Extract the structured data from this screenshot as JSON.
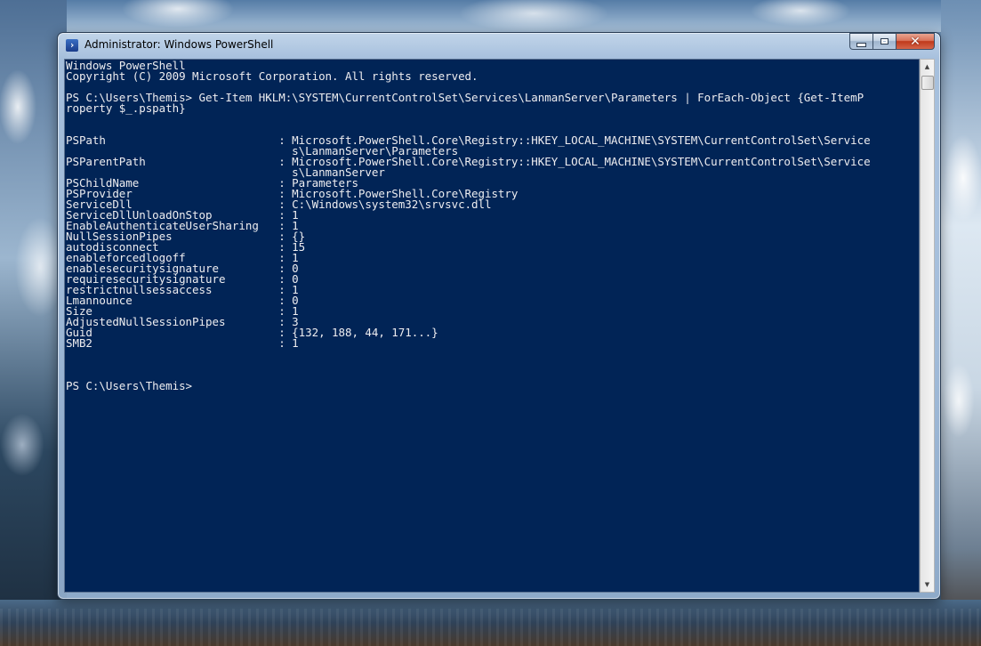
{
  "window": {
    "title": "Administrator: Windows PowerShell",
    "icon": "powershell-icon",
    "icon_glyph": "›",
    "close_glyph": "✕",
    "console_background": "#012456",
    "console_text_color": "#eeedf0"
  },
  "console": {
    "lines": [
      "Windows PowerShell",
      "Copyright (C) 2009 Microsoft Corporation. All rights reserved.",
      "",
      "PS C:\\Users\\Themis> Get-Item HKLM:\\SYSTEM\\CurrentControlSet\\Services\\LanmanServer\\Parameters | ForEach-Object {Get-ItemP",
      "roperty $_.pspath}",
      "",
      "",
      "PSPath                          : Microsoft.PowerShell.Core\\Registry::HKEY_LOCAL_MACHINE\\SYSTEM\\CurrentControlSet\\Service",
      "                                  s\\LanmanServer\\Parameters",
      "PSParentPath                    : Microsoft.PowerShell.Core\\Registry::HKEY_LOCAL_MACHINE\\SYSTEM\\CurrentControlSet\\Service",
      "                                  s\\LanmanServer",
      "PSChildName                     : Parameters",
      "PSProvider                      : Microsoft.PowerShell.Core\\Registry",
      "ServiceDll                      : C:\\Windows\\system32\\srvsvc.dll",
      "ServiceDllUnloadOnStop          : 1",
      "EnableAuthenticateUserSharing   : 1",
      "NullSessionPipes                : {}",
      "autodisconnect                  : 15",
      "enableforcedlogoff              : 1",
      "enablesecuritysignature         : 0",
      "requiresecuritysignature        : 0",
      "restrictnullsessaccess          : 1",
      "Lmannounce                      : 0",
      "Size                            : 1",
      "AdjustedNullSessionPipes        : 3",
      "Guid                            : {132, 188, 44, 171...}",
      "SMB2                            : 1",
      "",
      "",
      "",
      "PS C:\\Users\\Themis>"
    ]
  },
  "scrollbar": {
    "up_glyph": "▲",
    "down_glyph": "▼"
  }
}
